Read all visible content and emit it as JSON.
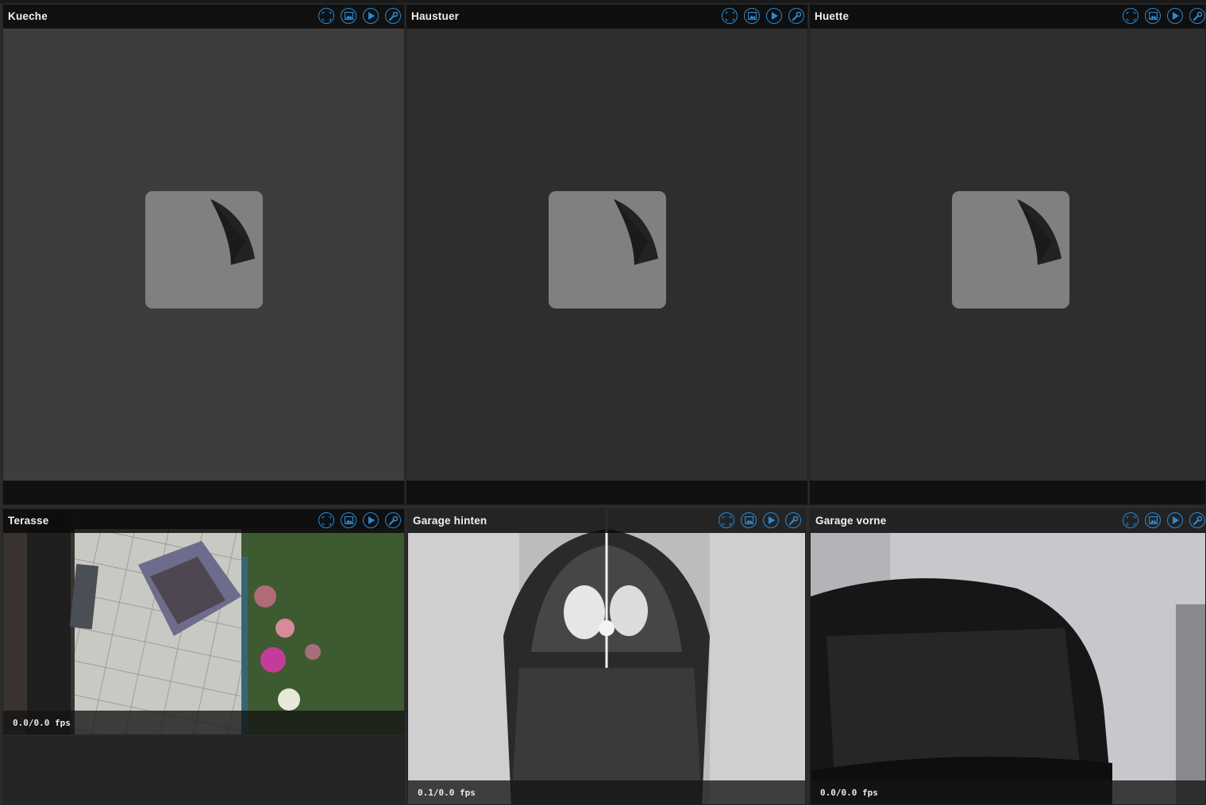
{
  "cameras": [
    {
      "title": "Kueche",
      "status": "offline"
    },
    {
      "title": "Haustuer",
      "status": "offline"
    },
    {
      "title": "Huette",
      "status": "offline"
    },
    {
      "title": "Terasse",
      "fps": "0.0/0.0 fps"
    },
    {
      "title": "Garage hinten",
      "fps": "0.1/0.0 fps"
    },
    {
      "title": "Garage vorne",
      "fps": "0.0/0.0 fps"
    }
  ],
  "icons": [
    "fullscreen-icon",
    "snapshot-icon",
    "play-icon",
    "settings-wrench-icon"
  ],
  "colors": {
    "accent": "#2a8ad4",
    "panel_bg": "#3d3d3d",
    "header_bg": "#0a0a0a",
    "placeholder": "#808080"
  }
}
